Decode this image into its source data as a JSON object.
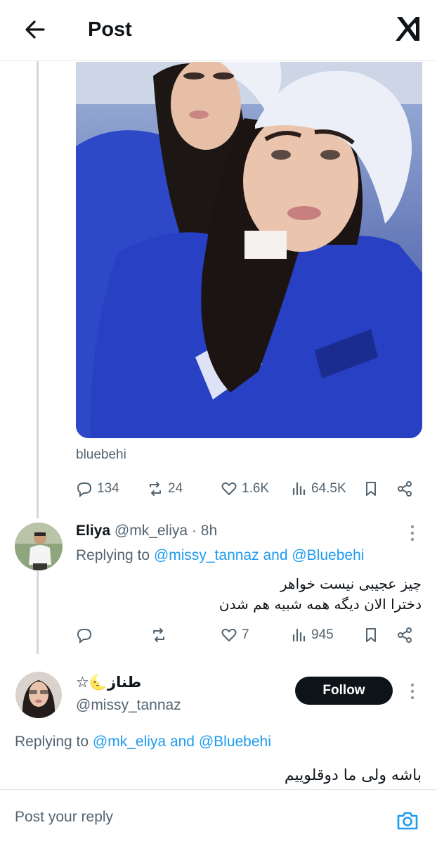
{
  "header": {
    "title": "Post"
  },
  "post": {
    "caption": "bluebehi",
    "stats": {
      "replies": "134",
      "reposts": "24",
      "likes": "1.6K",
      "views": "64.5K"
    }
  },
  "reply": {
    "name": "Eliya",
    "handle": "@mk_eliya",
    "separator": "·",
    "time": "8h",
    "replying_prefix": "Replying to",
    "replying_user1": "@missy_tannaz",
    "replying_and": "and",
    "replying_user2": "@Bluebehi",
    "line1": "چیز عجیبی نیست خواهر",
    "line2": "دخترا الان دیگه همه شبیه هم شدن",
    "stats": {
      "likes": "7",
      "views": "945"
    }
  },
  "main": {
    "name": "طناز",
    "name_emoji": "☆🌜",
    "handle": "@missy_tannaz",
    "follow_label": "Follow",
    "replying_prefix": "Replying to",
    "replying_user1": "@mk_eliya",
    "replying_and": "and",
    "replying_user2": "@Bluebehi",
    "text": "باشه ولی ما دوقلوییم"
  },
  "composer": {
    "placeholder": "Post your reply"
  },
  "icons": {
    "back": "arrow-left-icon",
    "logo": "x-logo-icon",
    "reply": "reply-bubble-icon",
    "repost": "repost-icon",
    "like": "heart-icon",
    "views": "views-bar-icon",
    "bookmark": "bookmark-icon",
    "share": "share-icon",
    "more": "more-vertical-icon",
    "camera": "camera-icon"
  },
  "colors": {
    "link": "#1d9bf0",
    "muted": "#536471",
    "text": "#0f1419",
    "follow_bg": "#0f1419"
  }
}
